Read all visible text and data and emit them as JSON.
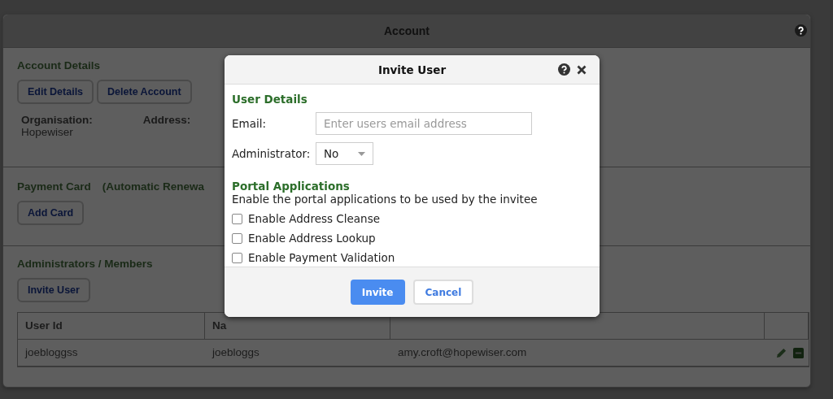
{
  "panel": {
    "title": "Account"
  },
  "account_details": {
    "heading": "Account Details",
    "buttons": [
      "Edit Details",
      "Delete Account"
    ],
    "fields": [
      {
        "label": "Organisation:",
        "value": "Hopewiser"
      },
      {
        "label": "Address:"
      }
    ]
  },
  "payment_card": {
    "heading": "Payment Card",
    "note": "(Automatic Renewa",
    "buttons": [
      "Add Card"
    ]
  },
  "administrators": {
    "heading": "Administrators / Members",
    "buttons": [
      "Invite User"
    ],
    "table": {
      "columns": [
        "User Id",
        "Na"
      ],
      "rows": [
        {
          "cells": [
            "joebloggss",
            "joebloggs",
            "amy.croft@hopewiser.com"
          ]
        }
      ]
    }
  },
  "dialog": {
    "title": "Invite User",
    "user_details_heading": "User Details",
    "email": {
      "label": "Email:",
      "placeholder": "Enter users email address"
    },
    "administrator": {
      "label": "Administrator:",
      "value": "No"
    },
    "portal_heading": "Portal Applications",
    "portal_text": "Enable the portal applications to be used by the invitee",
    "options": [
      {
        "label": "Enable Address Cleanse",
        "checked": false
      },
      {
        "label": "Enable Address Lookup",
        "checked": false
      },
      {
        "label": "Enable Payment Validation",
        "checked": false
      }
    ],
    "buttons": [
      {
        "label": "Invite",
        "kind": "primary"
      },
      {
        "label": "Cancel",
        "kind": "secondary"
      }
    ]
  }
}
